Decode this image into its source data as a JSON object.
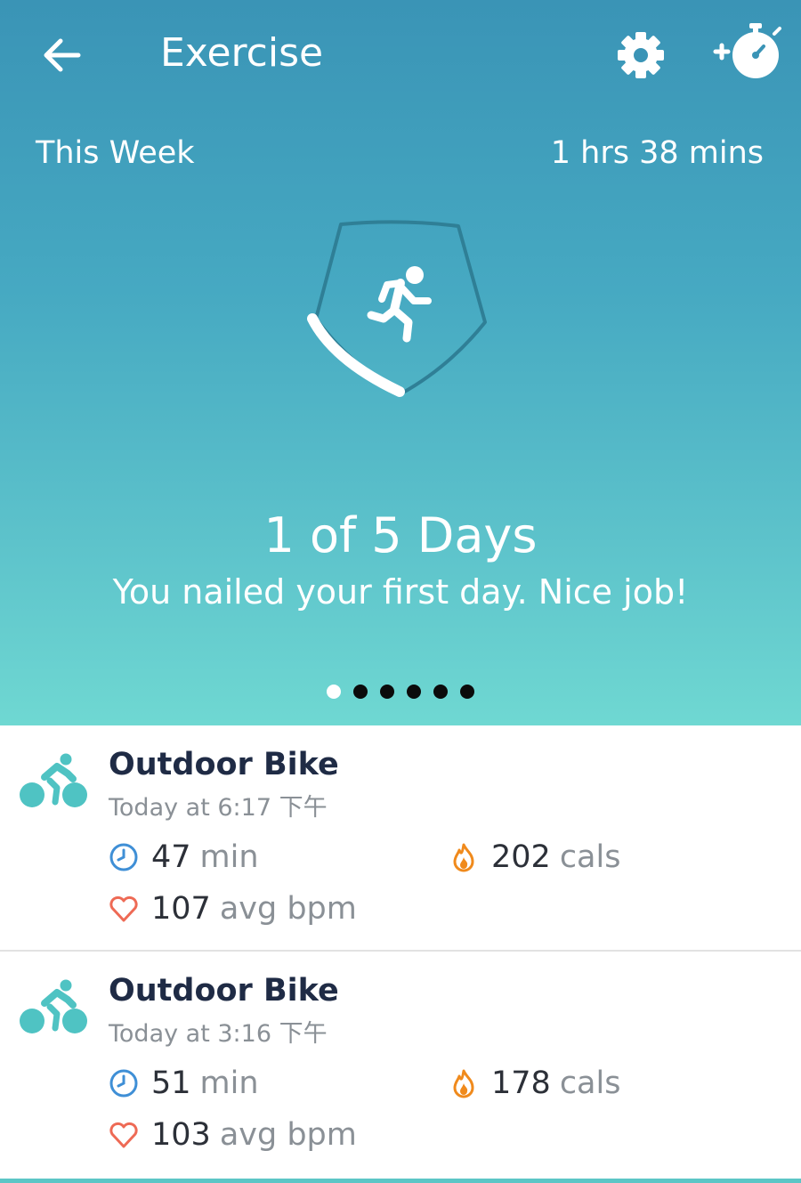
{
  "header": {
    "title": "Exercise",
    "back_icon": "arrow-left-icon",
    "settings_icon": "gear-icon",
    "add_timer_icon": "stopwatch-plus-icon"
  },
  "summary": {
    "period_label": "This Week",
    "total_duration": "1 hrs 38 mins",
    "badge_icon": "running-person-icon",
    "progress_days": 1,
    "goal_days": 5,
    "days_title": "1 of 5 Days",
    "message": "You nailed your first day. Nice job!"
  },
  "pager": {
    "count": 6,
    "active_index": 0
  },
  "colors": {
    "header_gradient_top": "#3a94b6",
    "header_gradient_bottom": "#6fd8d2",
    "accent_teal": "#4fc3c3",
    "clock_blue": "#3f8fd6",
    "flame_orange": "#f08a1c",
    "heart_red": "#ee6a55"
  },
  "exercises": [
    {
      "name": "Outdoor Bike",
      "time": "Today at 6:17 下午",
      "duration_value": "47",
      "duration_unit": "min",
      "calories_value": "202",
      "calories_unit": "cals",
      "heart_value": "107",
      "heart_unit": "avg bpm",
      "icon": "bike-icon"
    },
    {
      "name": "Outdoor Bike",
      "time": "Today at 3:16 下午",
      "duration_value": "51",
      "duration_unit": "min",
      "calories_value": "178",
      "calories_unit": "cals",
      "heart_value": "103",
      "heart_unit": "avg bpm",
      "icon": "bike-icon"
    }
  ]
}
